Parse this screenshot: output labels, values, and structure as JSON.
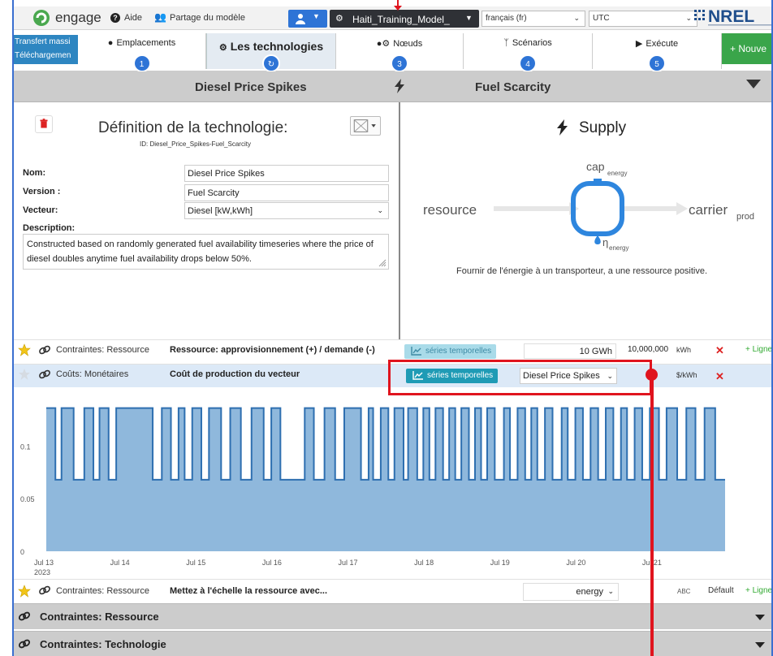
{
  "topbar": {
    "app_name": "engage",
    "help_label": "Aide",
    "share_label": "Partage du modèle",
    "model_name": "Haiti_Training_Model_",
    "language": "français (fr)",
    "timezone": "UTC",
    "org_logo": "NREL"
  },
  "stepnav": {
    "upload_lines": [
      "Transfert massi",
      "Téléchargemen"
    ],
    "steps": [
      {
        "label": "Emplacements",
        "icon": "map-marker-icon",
        "badge": "1"
      },
      {
        "label": "Les technologies",
        "icon": "gear-icon",
        "badge": "refresh-icon"
      },
      {
        "label": "Nœuds",
        "icon": "map-marker-gear-icon",
        "badge": "3"
      },
      {
        "label": "Scénarios",
        "icon": "branch-icon",
        "badge": "4"
      },
      {
        "label": "Exécute",
        "icon": "play-icon",
        "badge": "5"
      }
    ],
    "new_button": "+ Nouve"
  },
  "techbar": {
    "name": "Diesel Price Spikes",
    "variant": "Fuel Scarcity"
  },
  "definition": {
    "title": "Définition de la technologie:",
    "id_line": "ID: Diesel_Price_Spikes-Fuel_Scarcity",
    "name_label": "Nom:",
    "name_value": "Diesel Price Spikes",
    "version_label": "Version :",
    "version_value": "Fuel Scarcity",
    "carrier_label": "Vecteur:",
    "carrier_value": "Diesel [kW,kWh]",
    "description_label": "Description:",
    "description_value": "Constructed based on randomly generated fuel availability timeseries where the price of diesel doubles anytime fuel availability drops below 50%."
  },
  "supply": {
    "title": "Supply",
    "input_label": "resource",
    "output_label": "carrier",
    "output_sub": "prod",
    "cap_label": "cap",
    "cap_sub": "energy",
    "eta_label": "η",
    "eta_sub": "energy",
    "description": "Fournir de l'énergie à un transporteur, a une ressource positive."
  },
  "constraints": {
    "resource_row": {
      "type": "Contraintes: Ressource",
      "name": "Ressource: approvisionnement (+) / demande (-)",
      "ts_label": "séries temporelles",
      "value": "10 GWh",
      "max_value": "10,000,000",
      "unit": "kWh",
      "add_label": "+ Ligne"
    },
    "cost_row": {
      "type": "Coûts: Monétaires",
      "name": "Coût de production du vecteur",
      "ts_label": "séries temporelles",
      "series_value": "Diesel Price Spikes",
      "unit": "$/kWh"
    },
    "scale_row": {
      "type": "Contraintes: Ressource",
      "name": "Mettez à l'échelle la ressource avec...",
      "select_value": "energy",
      "abc_label": "ABC",
      "default_label": "Défault",
      "add_label": "+ Ligne"
    }
  },
  "sections": {
    "resource": "Contraintes: Ressource",
    "technology": "Contraintes: Technologie"
  },
  "chart_data": {
    "type": "area",
    "y_ticks": [
      0,
      0.05,
      0.1
    ],
    "y_tick_labels": [
      "0",
      "0.05",
      "0.1"
    ],
    "ylim": [
      0,
      0.145
    ],
    "x_tick_labels": [
      "Jul 13",
      "Jul 14",
      "Jul 15",
      "Jul 16",
      "Jul 17",
      "Jul 18",
      "Jul 19",
      "Jul 20",
      "Jul 21"
    ],
    "x_year_label": "2023",
    "x_range_days": [
      0,
      8.93
    ],
    "low": 0.068,
    "high": 0.136,
    "segments": [
      [
        0.0,
        0.12,
        1
      ],
      [
        0.12,
        0.2,
        0
      ],
      [
        0.2,
        0.36,
        1
      ],
      [
        0.36,
        0.5,
        0
      ],
      [
        0.5,
        0.62,
        1
      ],
      [
        0.62,
        0.7,
        0
      ],
      [
        0.7,
        0.82,
        1
      ],
      [
        0.82,
        0.92,
        0
      ],
      [
        0.92,
        1.4,
        1
      ],
      [
        1.4,
        1.52,
        0
      ],
      [
        1.52,
        1.64,
        1
      ],
      [
        1.64,
        1.74,
        0
      ],
      [
        1.74,
        1.82,
        1
      ],
      [
        1.82,
        1.92,
        0
      ],
      [
        1.92,
        2.04,
        1
      ],
      [
        2.04,
        2.14,
        0
      ],
      [
        2.14,
        2.3,
        1
      ],
      [
        2.3,
        2.42,
        0
      ],
      [
        2.42,
        2.56,
        1
      ],
      [
        2.56,
        2.7,
        0
      ],
      [
        2.7,
        2.86,
        1
      ],
      [
        2.86,
        2.96,
        0
      ],
      [
        2.96,
        3.08,
        1
      ],
      [
        3.08,
        3.4,
        0
      ],
      [
        3.4,
        3.52,
        1
      ],
      [
        3.52,
        3.66,
        0
      ],
      [
        3.66,
        3.8,
        1
      ],
      [
        3.8,
        3.92,
        0
      ],
      [
        3.92,
        4.14,
        1
      ],
      [
        4.14,
        4.24,
        0
      ],
      [
        4.24,
        4.3,
        1
      ],
      [
        4.3,
        4.4,
        0
      ],
      [
        4.4,
        4.5,
        1
      ],
      [
        4.5,
        4.58,
        0
      ],
      [
        4.58,
        4.7,
        1
      ],
      [
        4.7,
        4.76,
        0
      ],
      [
        4.76,
        4.88,
        1
      ],
      [
        4.88,
        4.96,
        0
      ],
      [
        4.96,
        5.04,
        1
      ],
      [
        5.04,
        5.12,
        0
      ],
      [
        5.12,
        5.22,
        1
      ],
      [
        5.22,
        5.3,
        0
      ],
      [
        5.3,
        5.38,
        1
      ],
      [
        5.38,
        5.46,
        0
      ],
      [
        5.46,
        5.56,
        1
      ],
      [
        5.56,
        5.64,
        0
      ],
      [
        5.64,
        5.72,
        1
      ],
      [
        5.72,
        5.8,
        0
      ],
      [
        5.8,
        5.9,
        1
      ],
      [
        5.9,
        6.02,
        0
      ],
      [
        6.02,
        6.1,
        1
      ],
      [
        6.1,
        6.2,
        0
      ],
      [
        6.2,
        6.3,
        1
      ],
      [
        6.3,
        6.38,
        0
      ],
      [
        6.38,
        6.46,
        1
      ],
      [
        6.46,
        6.56,
        0
      ],
      [
        6.56,
        6.66,
        1
      ],
      [
        6.66,
        6.78,
        0
      ],
      [
        6.78,
        6.86,
        1
      ],
      [
        6.86,
        6.96,
        0
      ],
      [
        6.96,
        7.06,
        1
      ],
      [
        7.06,
        7.16,
        0
      ],
      [
        7.16,
        7.26,
        1
      ],
      [
        7.26,
        7.36,
        0
      ],
      [
        7.36,
        7.46,
        1
      ],
      [
        7.46,
        7.56,
        0
      ],
      [
        7.56,
        7.64,
        1
      ],
      [
        7.64,
        7.74,
        0
      ],
      [
        7.74,
        7.84,
        1
      ],
      [
        7.84,
        7.94,
        0
      ],
      [
        7.94,
        8.06,
        1
      ],
      [
        8.06,
        8.16,
        0
      ],
      [
        8.16,
        8.3,
        1
      ],
      [
        8.3,
        8.42,
        0
      ],
      [
        8.42,
        8.54,
        1
      ],
      [
        8.54,
        8.66,
        0
      ],
      [
        8.66,
        8.8,
        1
      ],
      [
        8.8,
        8.93,
        0
      ]
    ],
    "fill_color": "#8fb8dc",
    "line_color": "#2e6fb0"
  },
  "colors": {
    "accent": "#2e74d6",
    "timeseries_button": "#1f9bb5",
    "new_button": "#3aa54a",
    "delete": "#d22222",
    "annotation": "#e0141e"
  }
}
